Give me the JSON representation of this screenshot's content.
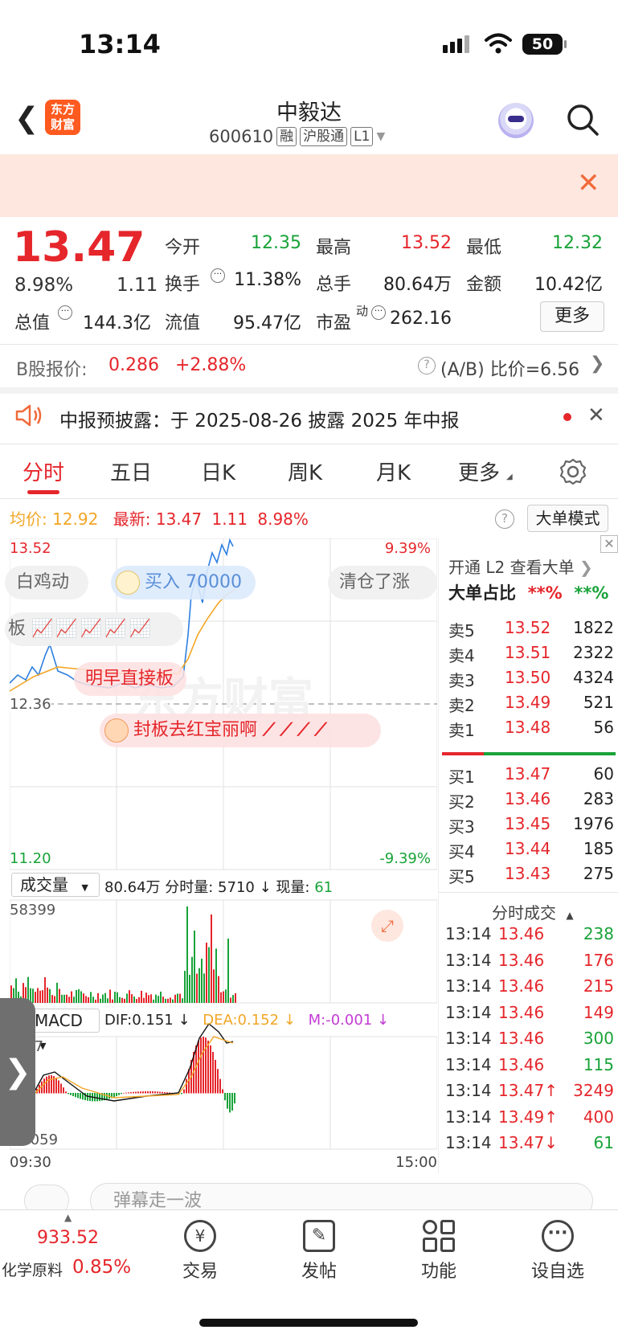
{
  "status": {
    "time": "13:14",
    "battery": "50"
  },
  "header": {
    "logo": "东方财富",
    "name": "中毅达",
    "code": "600610",
    "tags": [
      "融",
      "沪股通",
      "L1"
    ]
  },
  "quote": {
    "price": "13.47",
    "pct": "8.98%",
    "change": "1.11",
    "open_label": "今开",
    "open": "12.35",
    "high_label": "最高",
    "high": "13.52",
    "low_label": "最低",
    "low": "12.32",
    "turnover_label": "换手",
    "turnover": "11.38%",
    "volume_label": "总手",
    "volume": "80.64万",
    "amount_label": "金额",
    "amount": "10.42亿",
    "mktcap_label": "总值",
    "mktcap": "144.3亿",
    "float_label": "流值",
    "float": "95.47亿",
    "pe_label": "市盈",
    "pe_sup": "动",
    "pe": "262.16",
    "more": "更多"
  },
  "bshare": {
    "label": "B股报价:",
    "price": "0.286",
    "pct": "+2.88%",
    "ratio": "(A/B) 比价=6.56"
  },
  "notice": {
    "text": "中报预披露：于 2025-08-26 披露 2025 年中报"
  },
  "tabs": [
    "分时",
    "五日",
    "日K",
    "周K",
    "月K",
    "更多"
  ],
  "chart": {
    "avg_label": "均价:",
    "avg": "12.92",
    "latest_label": "最新:",
    "latest": "13.47",
    "chg": "1.11",
    "pct": "8.98%",
    "mode_btn": "大单模式",
    "y_top": "13.52",
    "y_top_pct": "9.39%",
    "y_bottom": "11.20",
    "y_bottom_pct": "-9.39%",
    "prev_close": "12.36",
    "watermark": "东方财富",
    "vol_selector": "成交量",
    "vol_info_total": "80.64万",
    "vol_info_rest": "分时量: 5710 ↓ 现量:",
    "vol_now": "61",
    "vol_max": "58399",
    "macd_selector": "MACD",
    "dif": "DIF:0.151 ↓",
    "dea": "DEA:0.152 ↓",
    "m": "M:-0.001 ↓",
    "macd_top": "0.07",
    "macd_bottom": "-0.059",
    "t_start": "09:30",
    "t_end": "15:00"
  },
  "danmu": [
    "白鸡动",
    "买入 70000",
    "清仓了涨",
    "板",
    "明早直接板",
    "封板去红宝丽啊"
  ],
  "orderbook": {
    "l2": "开通 L2 查看大单",
    "big_label": "大单占比",
    "big_a": "**%",
    "big_b": "**%",
    "asks": [
      {
        "label": "卖5",
        "price": "13.52",
        "vol": "1822"
      },
      {
        "label": "卖4",
        "price": "13.51",
        "vol": "2322"
      },
      {
        "label": "卖3",
        "price": "13.50",
        "vol": "4324"
      },
      {
        "label": "卖2",
        "price": "13.49",
        "vol": "521"
      },
      {
        "label": "卖1",
        "price": "13.48",
        "vol": "56"
      }
    ],
    "bids": [
      {
        "label": "买1",
        "price": "13.47",
        "vol": "60"
      },
      {
        "label": "买2",
        "price": "13.46",
        "vol": "283"
      },
      {
        "label": "买3",
        "price": "13.45",
        "vol": "1976"
      },
      {
        "label": "买4",
        "price": "13.44",
        "vol": "185"
      },
      {
        "label": "买5",
        "price": "13.43",
        "vol": "275"
      }
    ],
    "ticks_title": "分时成交",
    "ticks": [
      {
        "t": "13:14",
        "p": "13.46",
        "v": "238",
        "dir": "g"
      },
      {
        "t": "13:14",
        "p": "13.46",
        "v": "176",
        "dir": "r"
      },
      {
        "t": "13:14",
        "p": "13.46",
        "v": "215",
        "dir": "r"
      },
      {
        "t": "13:14",
        "p": "13.46",
        "v": "149",
        "dir": "r"
      },
      {
        "t": "13:14",
        "p": "13.46",
        "v": "300",
        "dir": "g"
      },
      {
        "t": "13:14",
        "p": "13.46",
        "v": "115",
        "dir": "g"
      },
      {
        "t": "13:14",
        "p": "13.47↑",
        "v": "3249",
        "dir": "r"
      },
      {
        "t": "13:14",
        "p": "13.49↑",
        "v": "400",
        "dir": "r"
      },
      {
        "t": "13:14",
        "p": "13.47↓",
        "v": "61",
        "dir": "g"
      }
    ]
  },
  "comment_placeholder": "弹幕走一波",
  "bottomnav": {
    "index_value": "933.52",
    "index_name": "化学原料",
    "index_pct": "0.85%",
    "items": [
      "交易",
      "发帖",
      "功能",
      "设自选"
    ]
  },
  "colors": {
    "up": "#e5262b",
    "down": "#19a339",
    "avg": "#f2a626",
    "price_line": "#2f7fe0"
  }
}
